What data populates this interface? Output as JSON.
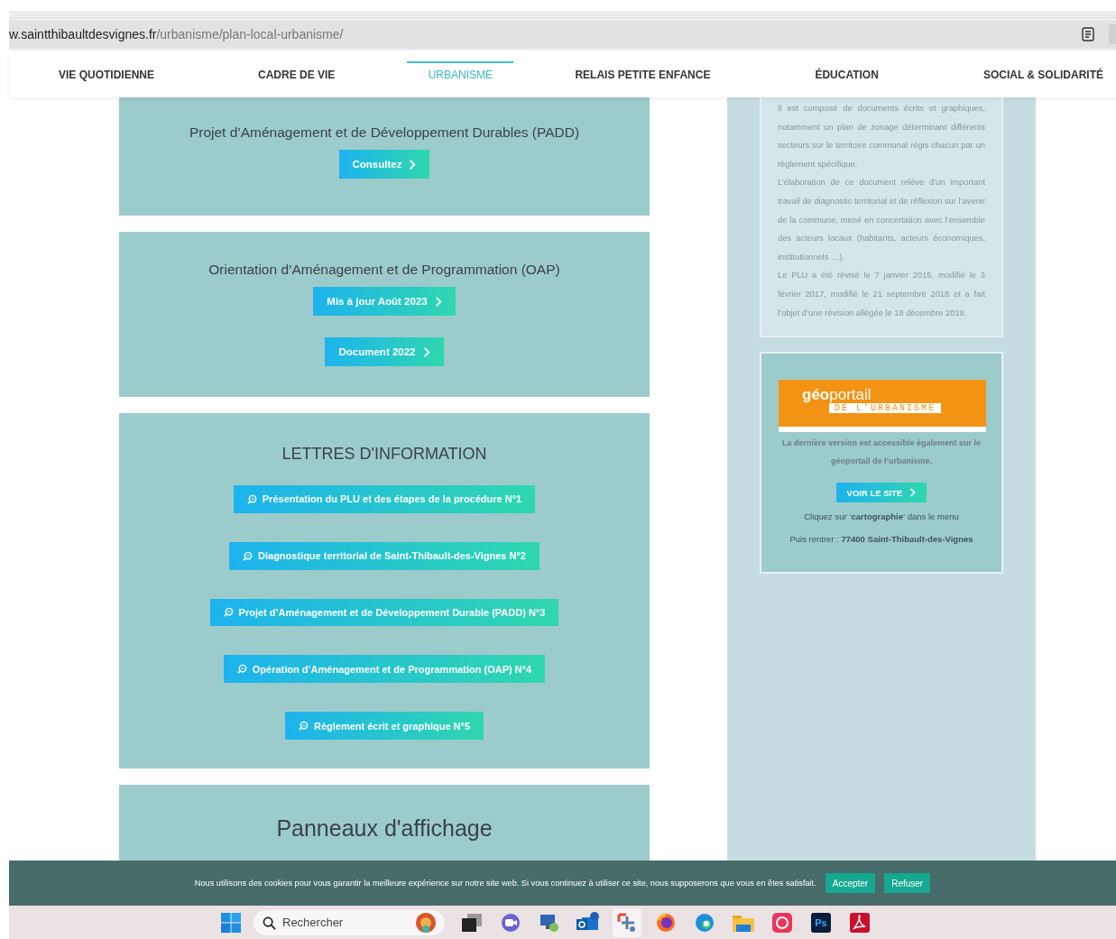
{
  "browser": {
    "url_host": "w.saintthibaultdesvignes.fr",
    "url_path": "/urbanisme/plan-local-urbanisme/"
  },
  "nav": [
    {
      "label": "VIE QUOTIDIENNE",
      "selected": false
    },
    {
      "label": "CADRE DE VIE",
      "selected": false
    },
    {
      "label": "URBANISME",
      "selected": true
    },
    {
      "label": "RELAIS PETITE ENFANCE",
      "selected": false
    },
    {
      "label": "ÉDUCATION",
      "selected": false
    },
    {
      "label": "SOCIAL & SOLIDARITÉ",
      "selected": false
    }
  ],
  "cards": [
    {
      "kind": "document",
      "title": "Projet d’Aménagement et de Développement Durables (PADD)",
      "buttons": [
        "Consultez"
      ]
    },
    {
      "kind": "document",
      "title": "Orientation d’Aménagement et de Programmation (OAP)",
      "buttons": [
        "Mis à jour Août 2023",
        "Document 2022"
      ]
    },
    {
      "kind": "newsletters",
      "title": "LETTRES D'INFORMATION",
      "buttons": [
        "Présentation du PLU et des étapes de la procédure N°1",
        "Diagnostique territorial de Saint-Thibault-des-Vignes N°2",
        "Projet d’Aménagement et de Développement Durable (PADD) N°3",
        "Opération d’Aménagement et de Programmation (OAP) N°4",
        "Règlement écrit et graphique N°5"
      ]
    },
    {
      "kind": "notice",
      "title": "Panneaux d'affichage"
    }
  ],
  "sidebar": {
    "paragraphs": [
      "Il est composé de documents écrits et graphiques, notamment un plan de zonage déterminant différents secteurs sur le territoire communal régis chacun par un règlement spécifique.",
      "L’élaboration de ce document relève d’un important travail de diagnostic territorial et de réflexion sur l’avenir de la commune, mené en concertation avec l’ensemble des acteurs locaux (habitants, acteurs économiques, institutionnels …).",
      "Le PLU  a été révisé le 7 janvier 2015, modifié le 3 février 2017, modifié le 21 septembre 2018 et a fait l’objet d’une révision allégée le 18 décembre 2019."
    ],
    "geoportail": {
      "logo_bold": "géo",
      "logo_light": "portail",
      "logo_subtitle": "DE L'URBANISME",
      "description": "La dernière version est accessible également sur le géoportail de l’urbanisme.",
      "button": "VOIR LE SITE",
      "hints": [
        "Cliquez sur ‘**cartographie**‘ dans le menu",
        "Puis rentrer : **77400 Saint-Thibault-des-Vignes**"
      ]
    }
  },
  "cookie_bar": {
    "text": "Nous utilisons des cookies pour vous garantir la meilleure expérience sur notre site web. Si vous continuez à utiliser ce site, nous supposerons que vous en êtes satisfait.",
    "buttons": [
      "Accepter",
      "Refuser"
    ]
  },
  "taskbar": {
    "search_placeholder": "Rechercher",
    "apps": [
      {
        "kind": "taskview",
        "selected": false
      },
      {
        "kind": "meet",
        "selected": false
      },
      {
        "kind": "remote",
        "selected": false
      },
      {
        "kind": "mail",
        "selected": false
      },
      {
        "kind": "snip",
        "selected": true
      },
      {
        "kind": "firefox",
        "selected": false
      },
      {
        "kind": "edge",
        "selected": false
      },
      {
        "kind": "folder",
        "selected": false
      },
      {
        "kind": "cloud",
        "selected": false
      },
      {
        "kind": "photoshop",
        "selected": false,
        "label": "Ps"
      },
      {
        "kind": "acrobat",
        "selected": false
      }
    ]
  }
}
